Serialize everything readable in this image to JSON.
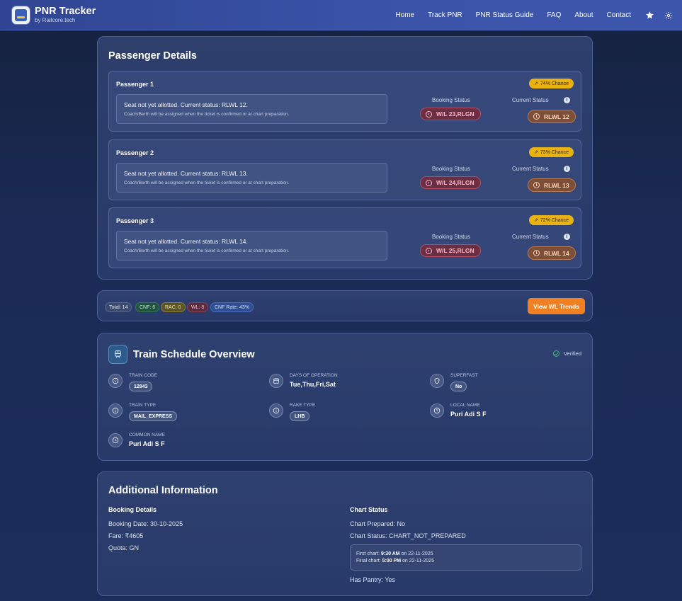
{
  "brand": {
    "title": "PNR Tracker",
    "subtitle": "by Railcore.tech",
    "logo_text": "PNR Tracker"
  },
  "nav": {
    "links": [
      "Home",
      "Track PNR",
      "PNR Status Guide",
      "FAQ",
      "About",
      "Contact"
    ]
  },
  "passenger_details": {
    "title": "Passenger Details",
    "booking_status_label": "Booking Status",
    "current_status_label": "Current Status",
    "passengers": [
      {
        "name": "Passenger 1",
        "chance": "74% Chance",
        "message": "Seat not yet allotted. Current status: RLWL 12.",
        "note": "Coach/Berth will be assigned when the ticket is confirmed or at chart preparation.",
        "booking_status": "W/L 23,RLGN",
        "current_status": "RLWL 12"
      },
      {
        "name": "Passenger 2",
        "chance": "73% Chance",
        "message": "Seat not yet allotted. Current status: RLWL 13.",
        "note": "Coach/Berth will be assigned when the ticket is confirmed or at chart preparation.",
        "booking_status": "W/L 24,RLGN",
        "current_status": "RLWL 13"
      },
      {
        "name": "Passenger 3",
        "chance": "72% Chance",
        "message": "Seat not yet allotted. Current status: RLWL 14.",
        "note": "Coach/Berth will be assigned when the ticket is confirmed or at chart preparation.",
        "booking_status": "W/L 25,RLGN",
        "current_status": "RLWL 14"
      }
    ]
  },
  "summary": {
    "total": "Total: 14",
    "cnf": "CNF: 6",
    "rac": "RAC: 0",
    "wl": "WL: 8",
    "cnf_rate": "CNF Rate: 43%",
    "trends_button": "View WL Trends"
  },
  "schedule": {
    "title": "Train Schedule Overview",
    "verified": "Verified",
    "train_code_label": "TRAIN CODE",
    "train_code": "12843",
    "days_label": "DAYS OF OPERATION",
    "days": "Tue,Thu,Fri,Sat",
    "superfast_label": "SUPERFAST",
    "superfast": "No",
    "train_type_label": "TRAIN TYPE",
    "train_type": "MAIL_EXPRESS",
    "rake_type_label": "RAKE TYPE",
    "rake_type": "LHB",
    "local_name_label": "LOCAL NAME",
    "local_name": "Puri Adi S F",
    "common_name_label": "COMMON NAME",
    "common_name": "Puri Adi S F"
  },
  "additional": {
    "title": "Additional Information",
    "booking_heading": "Booking Details",
    "booking_date": "Booking Date: 30-10-2025",
    "fare": "Fare: ₹4605",
    "quota": "Quota: GN",
    "chart_heading": "Chart Status",
    "chart_prepared": "Chart Prepared: No",
    "chart_status": "Chart Status: CHART_NOT_PREPARED",
    "first_chart_prefix": "First chart:",
    "first_chart_time": "9:30 AM",
    "first_chart_suffix": "on 22-11-2025",
    "final_chart_prefix": "Final chart:",
    "final_chart_time": "5:00 PM",
    "final_chart_suffix": "on 22-11-2025",
    "pantry": "Has Pantry: Yes"
  }
}
